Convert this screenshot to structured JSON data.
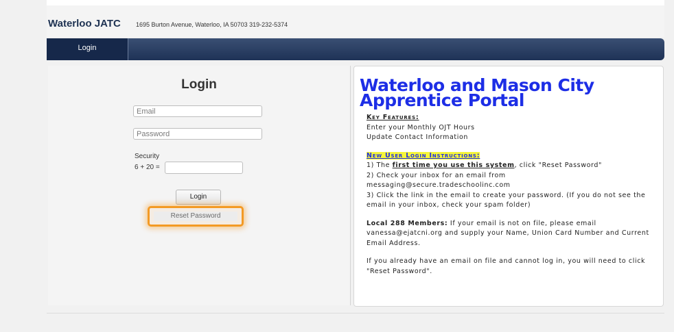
{
  "header": {
    "brand": "Waterloo JATC",
    "address": "1695 Burton Avenue, Waterloo, IA 50703   319-232-5374"
  },
  "nav": {
    "login": "Login"
  },
  "login_form": {
    "title": "Login",
    "email_placeholder": "Email",
    "password_placeholder": "Password",
    "security_label": "Security",
    "captcha_expr": "6 + 20  =",
    "login_button": "Login",
    "reset_button": "Reset Password"
  },
  "info": {
    "title_line1": "Waterloo and Mason City",
    "title_line2": "Apprentice Portal",
    "key_features_heading": "Key Features:",
    "feature_1": "Enter your Monthly OJT Hours",
    "feature_2": "Update Contact Information",
    "new_user_heading": "New User Login Instructions:",
    "step1_prefix": "1) The ",
    "step1_emph": "first time you use this system",
    "step1_suffix": ", click \"Reset Password\"",
    "step2_line1": "2) Check your inbox for an email from",
    "step2_email": "messaging@secure.tradeschoolinc.com",
    "step3": "3) Click the link in the email to create your password. (If you do not see the email in your inbox, check your spam folder)",
    "local_heading": "Local 288 Members:",
    "local_text1": " If your email is not on file, please email",
    "local_email": "vanessa@ejatcni.org",
    "local_text2": " and supply your Name, Union Card Number and Current Email Address.",
    "reset_note": "If you already have an email on file and cannot log in, you will need to click \"Reset Password\"."
  }
}
